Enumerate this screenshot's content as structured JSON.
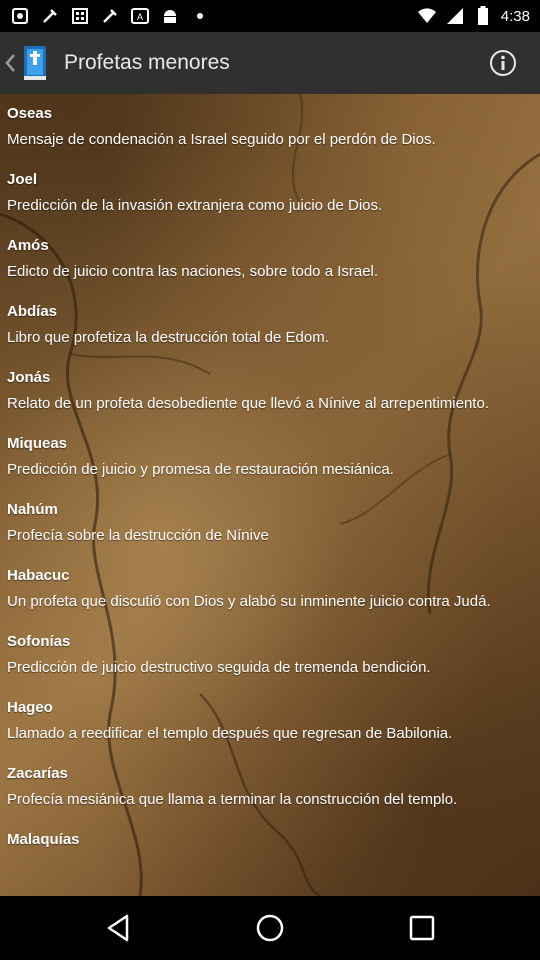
{
  "status_bar": {
    "time": "4:38",
    "left_icons": [
      "notification-icon",
      "tools-icon",
      "calendar-icon",
      "tools-icon",
      "translate-icon",
      "android-icon",
      "dots-icon"
    ],
    "right_icons": [
      "wifi-icon",
      "signal-icon",
      "battery-icon"
    ]
  },
  "action_bar": {
    "title": "Profetas menores",
    "back_icon": "chevron-left-icon",
    "app_icon": "bible-app-icon",
    "info_icon": "info-icon",
    "background": "#303030"
  },
  "books": [
    {
      "title": "Oseas",
      "description": "Mensaje de condenación a Israel seguido por el perdón de Dios."
    },
    {
      "title": "Joel",
      "description": "Predicción de la invasión extranjera como juicio de Dios."
    },
    {
      "title": "Amós",
      "description": "Edicto de juicio contra las naciones, sobre todo a Israel."
    },
    {
      "title": "Abdías",
      "description": "Libro que profetiza la destrucción total de Edom."
    },
    {
      "title": "Jonás",
      "description": "Relato de un profeta desobediente que llevó a Nínive al arrepentimiento."
    },
    {
      "title": "Miqueas",
      "description": "Predicción de juicio y promesa de restauración mesiánica."
    },
    {
      "title": "Nahúm",
      "description": "Profecía sobre la destrucción de Nínive"
    },
    {
      "title": "Habacuc",
      "description": "Un profeta que discutió con Dios y alabó su inminente juicio contra Judá."
    },
    {
      "title": "Sofonías",
      "description": "Predicción de juicio destructivo seguida de tremenda bendición."
    },
    {
      "title": "Hageo",
      "description": "Llamado a reedificar el templo después que regresan de Babilonia."
    },
    {
      "title": "Zacarías",
      "description": "Profecía mesiánica que llama a terminar la construcción del templo."
    },
    {
      "title": "Malaquías",
      "description": ""
    }
  ],
  "nav_bar": {
    "icons": [
      "back-triangle-icon",
      "home-circle-icon",
      "recents-square-icon"
    ]
  }
}
